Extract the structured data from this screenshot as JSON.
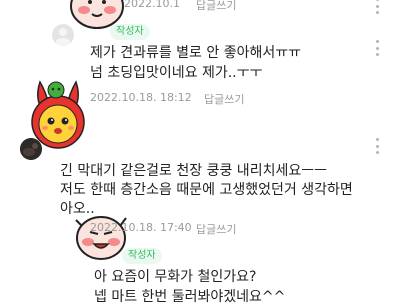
{
  "comments": [
    {
      "date": "2022.10.1",
      "reply_label": "답글쓰기"
    },
    {
      "author_badge": "작성자",
      "lines": [
        "제가 견과류를 별로 안 좋아해서ㅠㅠ",
        "넘 초딩입맛이네요 제가..ㅜㅜ"
      ],
      "date": "2022.10.18. 18:12",
      "reply_label": "답글쓰기"
    },
    {
      "lines": [
        "긴 막대기 같은걸로 천장 쿵쿵 내리치세요ㅡㅡ",
        "저도 한때 층간소음 때문에 고생했었던거 생각하면",
        "아오.."
      ],
      "date": "2022.10.18. 17:40",
      "reply_label": "답글쓰기"
    },
    {
      "author_badge": "작성자",
      "lines": [
        "아 요즘이 무화가 철인가요?",
        "넵 마트 한번 둘러봐야겠네요^^"
      ]
    }
  ]
}
